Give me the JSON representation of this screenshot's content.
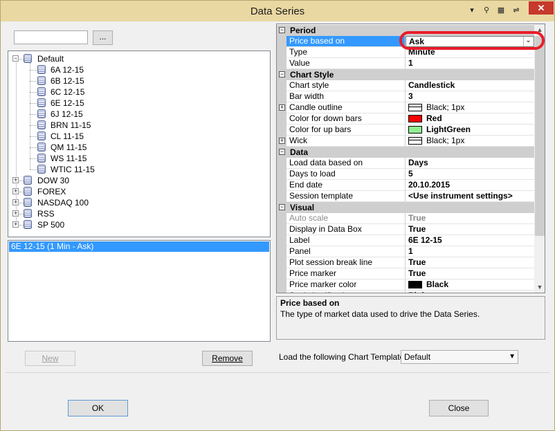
{
  "window": {
    "title": "Data Series",
    "close_glyph": "✕",
    "title_icons": [
      "filter-icon",
      "pin-icon",
      "grid-icon",
      "link-icon"
    ]
  },
  "search": {
    "value": "",
    "browse_label": "..."
  },
  "instrument_tree": {
    "groups": [
      {
        "label": "Default",
        "expanded": true,
        "children": [
          "6A 12-15",
          "6B 12-15",
          "6C 12-15",
          "6E 12-15",
          "6J 12-15",
          "BRN 11-15",
          "CL 11-15",
          "QM 11-15",
          "WS 11-15",
          "WTIC 11-15"
        ]
      },
      {
        "label": "DOW 30",
        "expanded": false
      },
      {
        "label": "FOREX",
        "expanded": false
      },
      {
        "label": "NASDAQ 100",
        "expanded": false
      },
      {
        "label": "RSS",
        "expanded": false
      },
      {
        "label": "SP 500",
        "expanded": false
      }
    ]
  },
  "series_list": {
    "items": [
      "6E 12-15 (1 Min - Ask)"
    ]
  },
  "buttons": {
    "new": "New",
    "remove": "Remove",
    "ok": "OK",
    "close": "Close"
  },
  "properties": {
    "categories": [
      {
        "name": "Period",
        "rows": [
          {
            "name": "Price based on",
            "value": "Ask",
            "selected": true,
            "dropdown": true
          },
          {
            "name": "Type",
            "value": "Minute"
          },
          {
            "name": "Value",
            "value": "1"
          }
        ]
      },
      {
        "name": "Chart Style",
        "rows": [
          {
            "name": "Chart style",
            "value": "Candlestick"
          },
          {
            "name": "Bar width",
            "value": "3"
          },
          {
            "name": "Candle outline",
            "value": "Black; 1px",
            "expandable": true,
            "swatch": "line"
          },
          {
            "name": "Color for down bars",
            "value": "Red",
            "swatch_color": "#ff0000"
          },
          {
            "name": "Color for up bars",
            "value": "LightGreen",
            "swatch_color": "#90ee90"
          },
          {
            "name": "Wick",
            "value": "Black; 1px",
            "expandable": true,
            "swatch": "line"
          }
        ]
      },
      {
        "name": "Data",
        "rows": [
          {
            "name": "Load data based on",
            "value": "Days"
          },
          {
            "name": "Days to load",
            "value": "5"
          },
          {
            "name": "End date",
            "value": "20.10.2015"
          },
          {
            "name": "Session template",
            "value": "<Use instrument settings>"
          }
        ]
      },
      {
        "name": "Visual",
        "rows": [
          {
            "name": "Auto scale",
            "value": "True",
            "disabled": true
          },
          {
            "name": "Display in Data Box",
            "value": "True"
          },
          {
            "name": "Label",
            "value": "6E 12-15"
          },
          {
            "name": "Panel",
            "value": "1"
          },
          {
            "name": "Plot session break line",
            "value": "True"
          },
          {
            "name": "Price marker",
            "value": "True"
          },
          {
            "name": "Price marker color",
            "value": "Black",
            "swatch_color": "#000000"
          },
          {
            "name": "Scale justification",
            "value": "Right"
          }
        ]
      }
    ]
  },
  "description": {
    "title": "Price based on",
    "text": "The type of market data used to drive the Data Series."
  },
  "template": {
    "label": "Load the following Chart Template:",
    "value": "Default"
  },
  "colors": {
    "selection": "#3399ff",
    "annotation": "#ea1c2a",
    "title_bar": "#ead8a2"
  }
}
